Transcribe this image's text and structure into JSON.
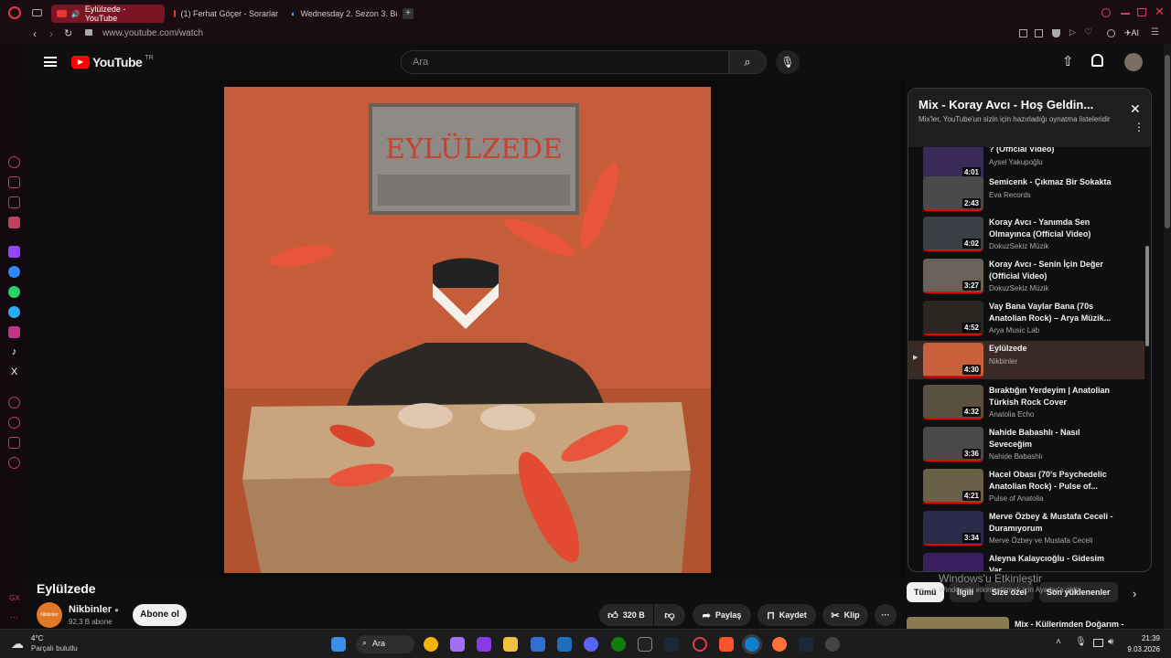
{
  "browser": {
    "tabs": [
      {
        "label": "Eylülzede - YouTube"
      },
      {
        "label": "(1) Ferhat Göçer - Sorarlar"
      },
      {
        "label": "Wednesday 2. Sezon 3. Bö"
      }
    ],
    "url": "www.youtube.com/watch",
    "ai_label": "AI"
  },
  "yt": {
    "logo": "YouTube",
    "region": "TR",
    "search_placeholder": "Ara"
  },
  "artwork": {
    "text": "EYLÜLZEDE"
  },
  "playlist": {
    "title": "Mix - Koray Avcı - Hoş Geldin...",
    "subtitle": "Mix'ler, YouTube'un sizin için hazırladığı oynatma listeleridir",
    "items": [
      {
        "title": "? (Official Video)",
        "author": "Aysel Yakupoğlu",
        "duration": "4:01",
        "color": "#3a2a5a"
      },
      {
        "title": "Semicenk - Çıkmaz Bir Sokakta",
        "author": "Eva Records",
        "duration": "2:43",
        "color": "#4a4a4a"
      },
      {
        "title": "Koray Avcı - Yanımda Sen Olmayınca (Official Video)",
        "author": "DokuzSekiz Müzik",
        "duration": "4:02",
        "color": "#3a3f45"
      },
      {
        "title": "Koray Avcı - Senin İçin Değer (Official Video)",
        "author": "DokuzSekiz Müzik",
        "duration": "3:27",
        "color": "#6a6258"
      },
      {
        "title": "Vay Bana Vaylar Bana (70s Anatolian Rock) – Arya Müzik...",
        "author": "Arya Music Lab",
        "duration": "4:52",
        "color": "#2a2620"
      },
      {
        "title": "Eylülzede",
        "author": "Nikbinler",
        "duration": "4:30",
        "color": "#c8603c"
      },
      {
        "title": "Bıraktığın Yerdeyim | Anatolian Türkish Rock Cover",
        "author": "Anatolia Echo",
        "duration": "4:32",
        "color": "#5a5040"
      },
      {
        "title": "Nahide Babashlı - Nasıl Seveceğim",
        "author": "Nahide Babashlı",
        "duration": "3:36",
        "color": "#4a4848"
      },
      {
        "title": "Hacel Obası (70's Psychedelic Anatolian Rock) - Pulse of...",
        "author": "Pulse of Anatolia",
        "duration": "4:21",
        "color": "#6a6048"
      },
      {
        "title": "Merve Özbey & Mustafa Ceceli - Duramıyorum",
        "author": "Merve Özbey ve Mustafa Ceceli",
        "duration": "3:34",
        "color": "#2a2a4a"
      },
      {
        "title": "Aleyna Kalaycıoğlu - Gidesim Var",
        "author": "",
        "duration": "",
        "color": "#3a2060"
      }
    ]
  },
  "video": {
    "title": "Eylülzede",
    "channel": "Nikbinler",
    "subs": "92,3 B abone",
    "subscribe": "Abone ol",
    "likes": "320 B",
    "share": "Paylaş",
    "save": "Kaydet",
    "clip": "Klip",
    "channel_logo": "Nikbinler"
  },
  "chips": [
    "Tümü",
    "İlgili",
    "Size özel",
    "Son yüklenenler"
  ],
  "next_video": "Mix - Küllerimden Doğarım -",
  "watermark": {
    "line1": "Windows'u Etkinleştir",
    "line2": "Windows'u etkinleştirmek için Ayarlar'a gidin."
  },
  "sidebar_bottom": "GX",
  "taskbar": {
    "temp": "4°C",
    "weather": "Parçalı bulutlu",
    "search": "Ara",
    "time": "21:39",
    "date": "9.03.2026"
  }
}
